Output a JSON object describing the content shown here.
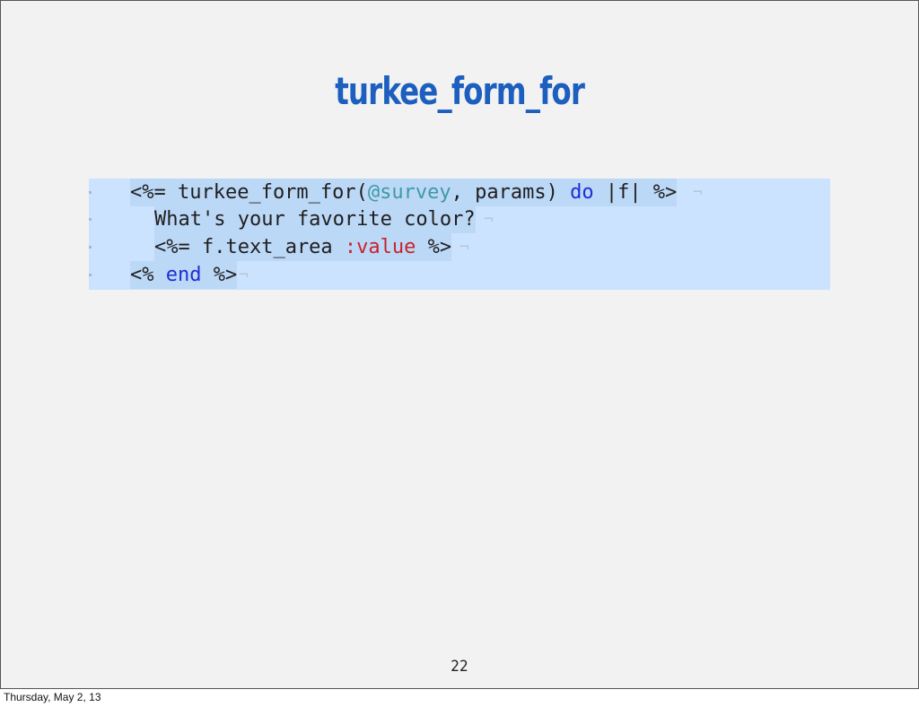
{
  "slide": {
    "title": "turkee_form_for",
    "page_number": "22"
  },
  "code": {
    "line1": {
      "open": "<%= turkee_form_for(",
      "ivar": "@survey",
      "mid": ", params) ",
      "kw": "do",
      "close": " |f| %>",
      "eol": "¬"
    },
    "line2": {
      "text": "What's your favorite color?",
      "eol": "¬"
    },
    "line3": {
      "open": "<%= f.text_area ",
      "sym": ":value",
      "close": " %>",
      "eol": "¬"
    },
    "line4": {
      "open": "<% ",
      "kw": "end",
      "close": " %>",
      "eol": "¬"
    }
  },
  "footer": {
    "date": "Thursday, May 2, 13"
  },
  "colors": {
    "title": "#1c5fbf",
    "code_background": "#cce3ff",
    "instance_variable": "#3f99a8",
    "keyword": "#1d2fd4",
    "symbol": "#c8232b"
  }
}
